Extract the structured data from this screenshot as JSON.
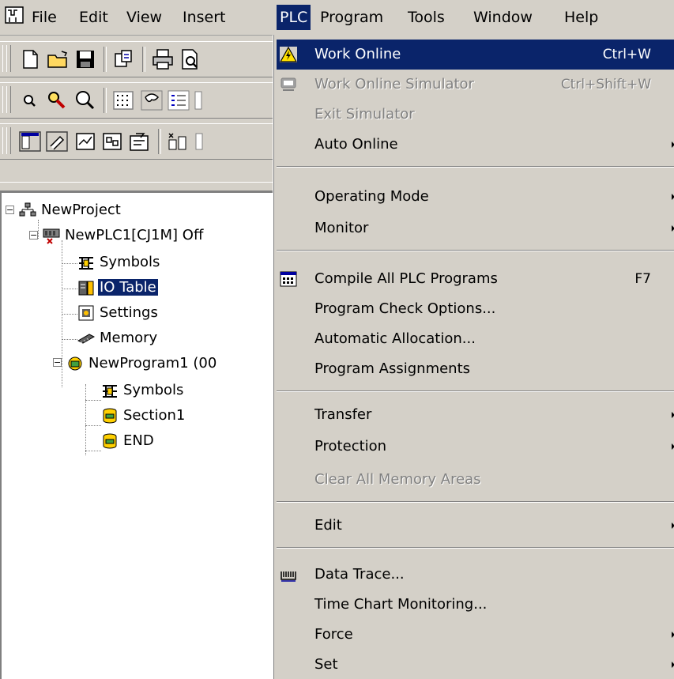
{
  "menubar": {
    "items": [
      {
        "label": "File"
      },
      {
        "label": "Edit"
      },
      {
        "label": "View"
      },
      {
        "label": "Insert"
      },
      {
        "label": "PLC"
      },
      {
        "label": "Program"
      },
      {
        "label": "Tools"
      },
      {
        "label": "Window"
      },
      {
        "label": "Help"
      }
    ],
    "active": "PLC"
  },
  "tree": {
    "nodes": [
      {
        "label": "NewProject",
        "icon": "project-icon"
      },
      {
        "label": "NewPLC1[CJ1M] Off",
        "icon": "plc-icon"
      },
      {
        "label": "Symbols",
        "icon": "symbols-icon"
      },
      {
        "label": "IO Table",
        "icon": "io-table-icon",
        "selected": true
      },
      {
        "label": "Settings",
        "icon": "settings-icon"
      },
      {
        "label": "Memory",
        "icon": "memory-icon"
      },
      {
        "label": "NewProgram1 (00",
        "icon": "program-icon"
      },
      {
        "label": "Symbols",
        "icon": "symbols-icon"
      },
      {
        "label": "Section1",
        "icon": "section-icon"
      },
      {
        "label": "END",
        "icon": "section-icon"
      }
    ]
  },
  "plc_menu": {
    "items": [
      {
        "label": "Work Online",
        "shortcut": "Ctrl+W",
        "icon": "warning-icon",
        "highlighted": true
      },
      {
        "label": "Work Online Simulator",
        "shortcut": "Ctrl+Shift+W",
        "icon": "simulator-icon",
        "disabled": true
      },
      {
        "label": "Exit Simulator",
        "disabled": true
      },
      {
        "label": "Auto Online",
        "submenu": true
      },
      {
        "label": "Operating Mode",
        "submenu": true
      },
      {
        "label": "Monitor",
        "submenu": true
      },
      {
        "label": "Compile All PLC Programs",
        "shortcut": "F7",
        "icon": "compile-icon"
      },
      {
        "label": "Program Check Options..."
      },
      {
        "label": "Automatic Allocation..."
      },
      {
        "label": "Program Assignments"
      },
      {
        "label": "Transfer",
        "submenu": true
      },
      {
        "label": "Protection",
        "submenu": true
      },
      {
        "label": "Clear All Memory Areas",
        "disabled": true
      },
      {
        "label": "Edit",
        "submenu": true
      },
      {
        "label": "Data Trace...",
        "icon": "data-trace-icon"
      },
      {
        "label": "Time Chart Monitoring..."
      },
      {
        "label": "Force",
        "submenu": true
      },
      {
        "label": "Set",
        "submenu": true
      }
    ]
  }
}
